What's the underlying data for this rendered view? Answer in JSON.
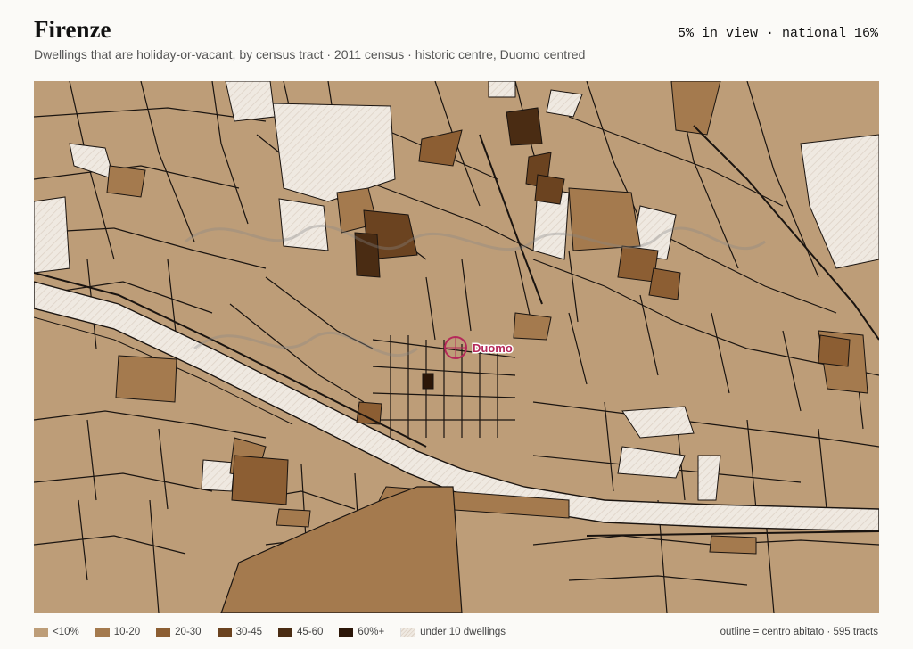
{
  "title": "Firenze",
  "subtitle": "Dwellings that are holiday-or-vacant, by census tract · 2011 census · historic centre, Duomo centred",
  "stat": "5% in view · national 16%",
  "marker_label": "Duomo",
  "legend": [
    {
      "label": "<10%",
      "color": "#bd9d78"
    },
    {
      "label": "10-20",
      "color": "#a47a4e"
    },
    {
      "label": "20-30",
      "color": "#8c5e33"
    },
    {
      "label": "30-45",
      "color": "#6b4320"
    },
    {
      "label": "45-60",
      "color": "#4a2c13"
    },
    {
      "label": "60%+",
      "color": "#2b1608"
    },
    {
      "label": "under 10 dwellings",
      "color": "#efe9e1",
      "hatched": true
    }
  ],
  "footnote": "outline = centro abitato · 595 tracts",
  "colors": {
    "river": "#efe9e1",
    "marker": "#b5295a",
    "background": "#fbfaf7"
  }
}
